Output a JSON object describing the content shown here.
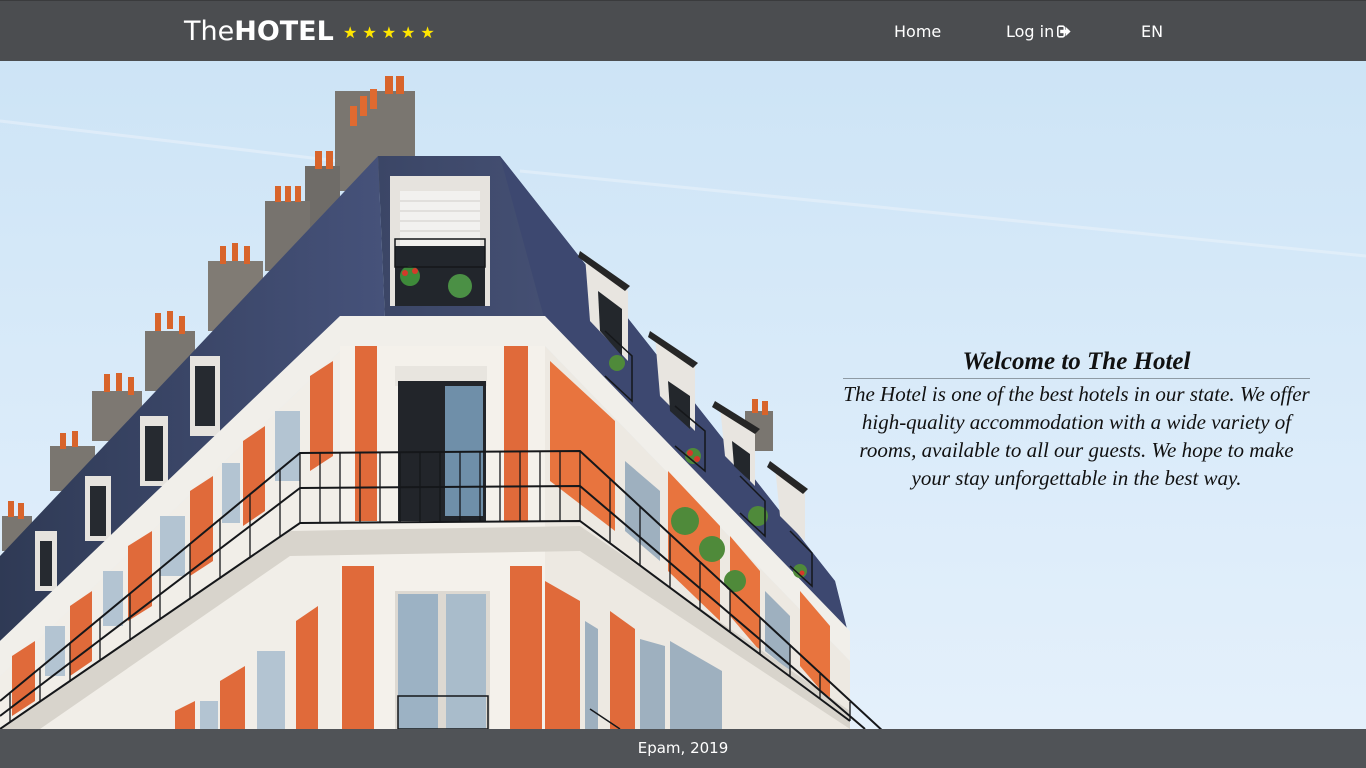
{
  "header": {
    "brand_prefix": "The",
    "brand_strong": "HOTEL",
    "stars": "★★★★★",
    "nav": {
      "home": "Home",
      "login": "Log in",
      "language": "EN"
    }
  },
  "hero": {
    "title": "Welcome to The Hotel",
    "text": "The Hotel is one of the best hotels in our state. We offer high-quality accommodation with a wide variety of rooms, available to all our guests. We hope to make your stay unforgettable in the best way."
  },
  "footer": {
    "text": "Epam, 2019"
  },
  "colors": {
    "header_bg": "#4b4d50",
    "stars": "#ffe600",
    "footer_bg": "#3c3e40"
  },
  "icons": {
    "login": "sign-in-icon"
  }
}
